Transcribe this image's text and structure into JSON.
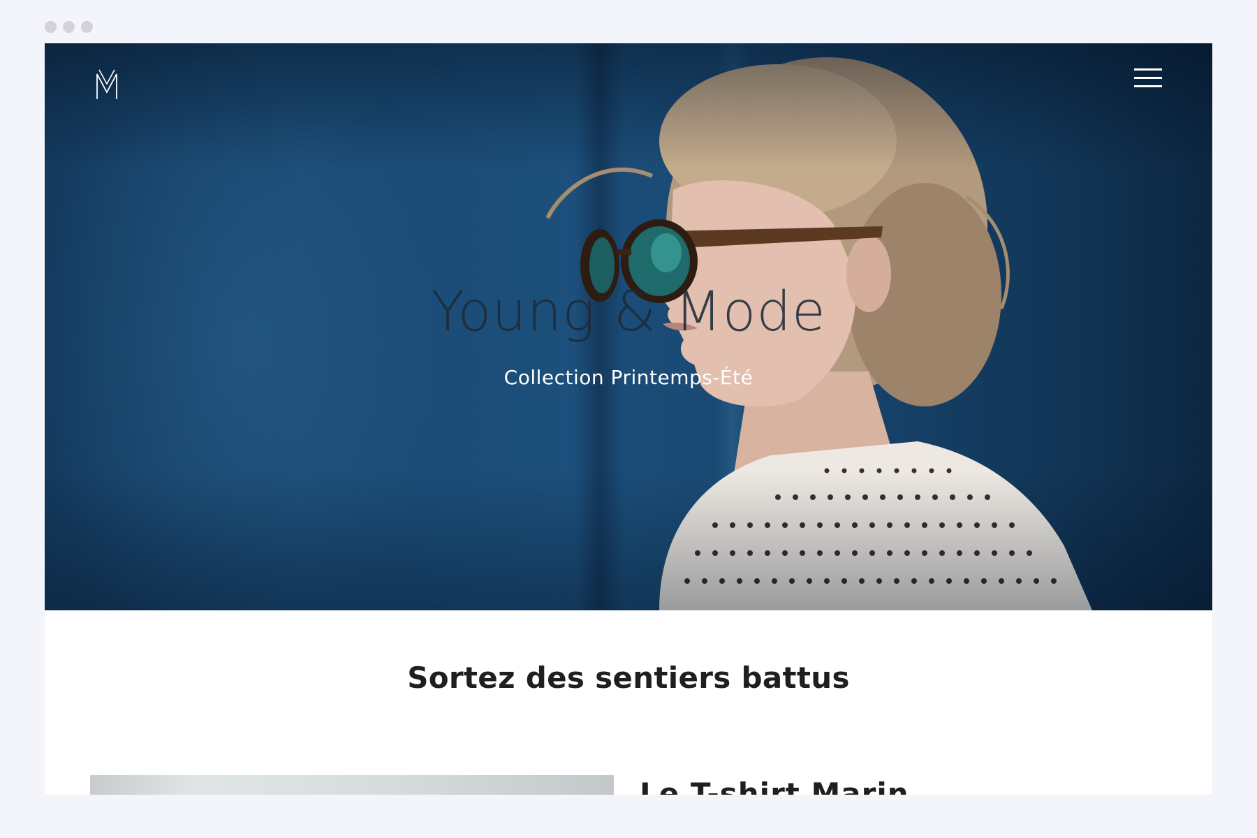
{
  "hero": {
    "title": "Young & Mode",
    "subtitle": "Collection Printemps-Été"
  },
  "section": {
    "title": "Sortez des sentiers battus"
  },
  "product": {
    "title": "Le T-shirt Marin"
  },
  "icons": {
    "logo": "monogram-m-logo",
    "menu": "hamburger-menu-icon"
  },
  "colors": {
    "hero_blue": "#1a4a74",
    "text_dark": "#1f1f1f",
    "page_bg": "#f4f4fb"
  }
}
